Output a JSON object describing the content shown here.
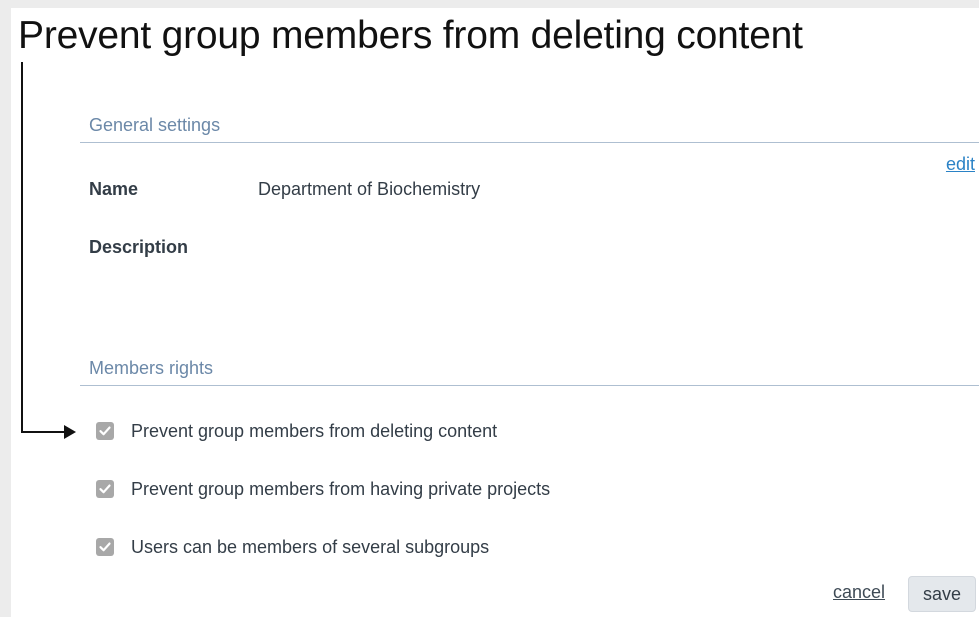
{
  "page": {
    "title": "Prevent group members from deleting content"
  },
  "general_settings": {
    "header": "General settings",
    "edit_label": "edit",
    "fields": {
      "name_label": "Name",
      "name_value": "Department of Biochemistry",
      "description_label": "Description",
      "description_value": ""
    }
  },
  "members_rights": {
    "header": "Members rights",
    "options": [
      {
        "label": "Prevent group members from deleting content",
        "checked": true
      },
      {
        "label": "Prevent group members from having private projects",
        "checked": true
      },
      {
        "label": "Users can be members of several subgroups",
        "checked": true
      }
    ]
  },
  "actions": {
    "cancel_label": "cancel",
    "save_label": "save"
  },
  "colors": {
    "section_header": "#6b88a8",
    "link": "#2a82c6",
    "checkbox": "#a8a8a8",
    "text": "#333d47"
  },
  "icons": {
    "checkbox": "checkmark-icon",
    "callout": "arrow-right-icon"
  }
}
